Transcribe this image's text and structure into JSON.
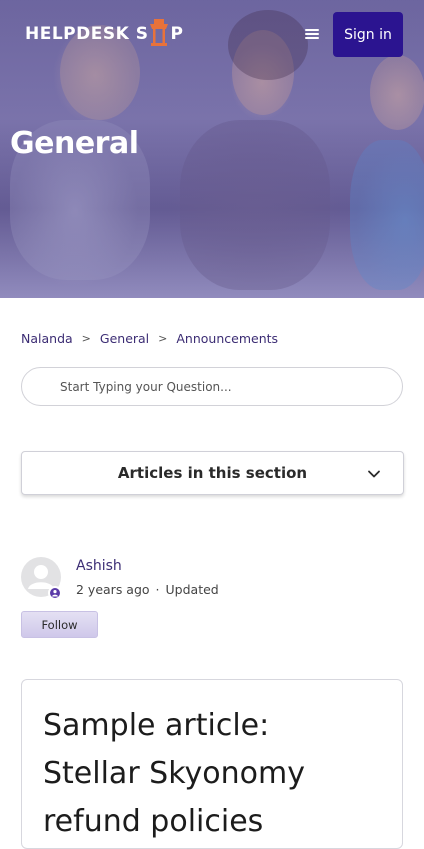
{
  "header": {
    "logo_prefix": "HELPDESK S",
    "logo_suffix": "P",
    "signin_label": "Sign in",
    "hero_title": "General"
  },
  "breadcrumb": [
    "Nalanda",
    "General",
    "Announcements"
  ],
  "search": {
    "placeholder": "Start Typing your Question..."
  },
  "articles_section": {
    "label": "Articles in this section"
  },
  "author": {
    "name": "Ashish",
    "time": "2 years ago",
    "updated": "Updated",
    "follow_label": "Follow"
  },
  "article": {
    "title": "Sample article: Stellar Skyonomy refund policies"
  },
  "colors": {
    "brand": "#2b1490",
    "accent_logo": "#e8723a",
    "link": "#3c2d74"
  },
  "icons": {
    "menu": "hamburger-icon",
    "search": "search-icon",
    "chevron": "chevron-down-icon",
    "avatar": "user-avatar-icon",
    "badge": "user-badge-icon"
  }
}
